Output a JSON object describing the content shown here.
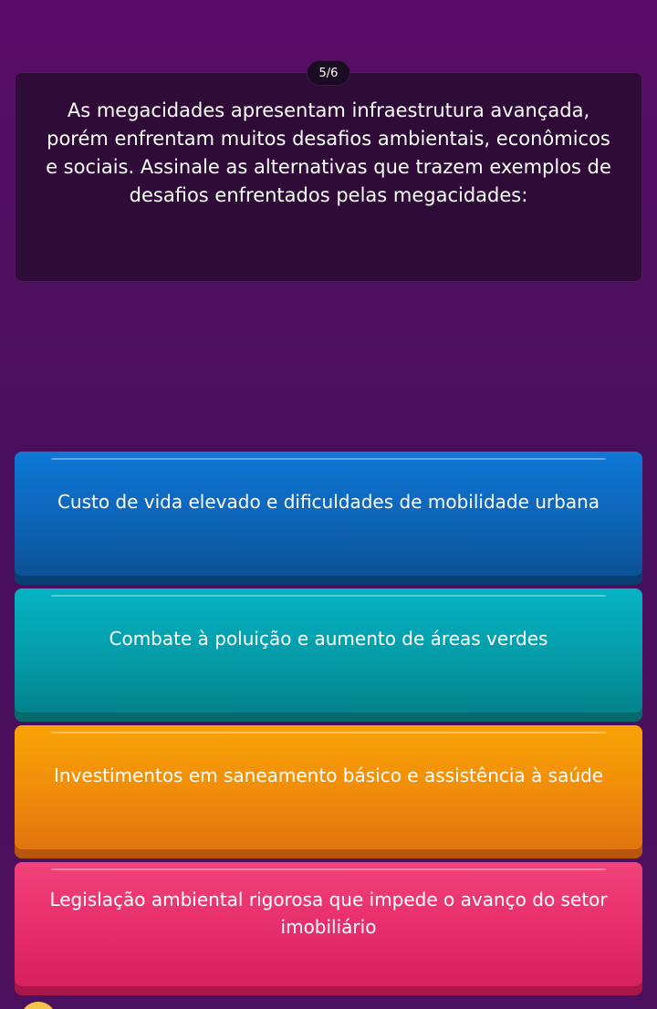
{
  "progress": {
    "counter": "5/6"
  },
  "question": {
    "text": "As megacidades apresentam infraestrutura avançada, porém enfrentam muitos desafios ambientais, econômicos e sociais. Assinale as alternativas que trazem exemplos de desafios enfrentados pelas megacidades:"
  },
  "options": [
    {
      "label": "Custo de vida elevado e dificuldades de mobilidade urbana",
      "color": "#0d62b3"
    },
    {
      "label": "Combate à poluição e aumento de áreas verdes",
      "color": "#049aa6"
    },
    {
      "label": "Investimentos em saneamento básico e assistência à saúde",
      "color": "#f08c0a"
    },
    {
      "label": "Legislação ambiental rigorosa que impede o avanço do setor imobiliário",
      "color": "#e52b6a"
    }
  ]
}
